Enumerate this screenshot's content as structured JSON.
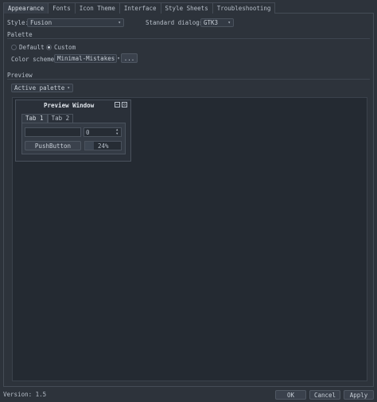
{
  "tabs": [
    {
      "label": "Appearance"
    },
    {
      "label": "Fonts"
    },
    {
      "label": "Icon Theme"
    },
    {
      "label": "Interface"
    },
    {
      "label": "Style Sheets"
    },
    {
      "label": "Troubleshooting"
    }
  ],
  "style": {
    "label": "Style:",
    "value": "Fusion"
  },
  "dialogs": {
    "label": "Standard dialogs:",
    "value": "GTK3"
  },
  "palette": {
    "title": "Palette",
    "default_label": "Default",
    "custom_label": "Custom",
    "selected": "Custom",
    "scheme_label": "Color scheme:",
    "scheme_value": "Minimal-Mistakes",
    "more_button": "..."
  },
  "preview": {
    "title": "Preview",
    "palette_select": "Active palette",
    "window_title": "Preview Window",
    "tab1": "Tab 1",
    "tab2": "Tab 2",
    "spin_value": "0",
    "push_button": "PushButton",
    "progress_text": "24%",
    "progress": 0.24
  },
  "footer": {
    "version": "Version: 1.5",
    "ok": "OK",
    "cancel": "Cancel",
    "apply": "Apply"
  }
}
